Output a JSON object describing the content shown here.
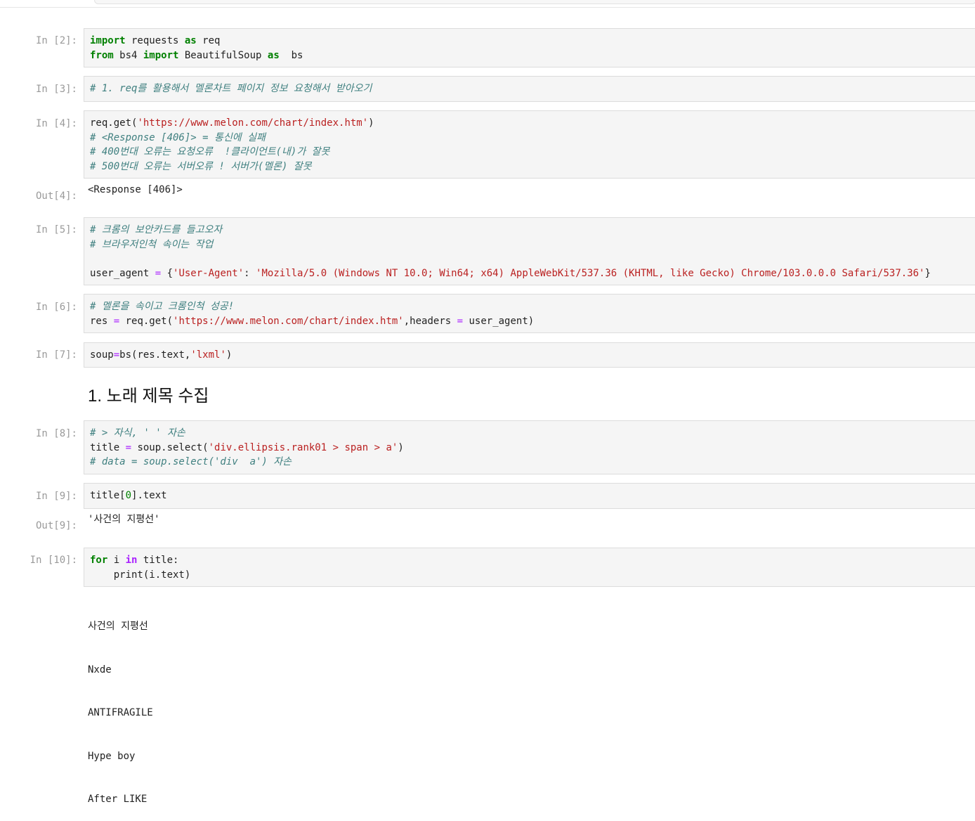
{
  "cells": [
    {
      "prompt": "In [2]:",
      "lines": [
        [
          [
            "kw",
            "import"
          ],
          [
            "t",
            " requests "
          ],
          [
            "kw",
            "as"
          ],
          [
            "t",
            " req"
          ]
        ],
        [
          [
            "kw",
            "from"
          ],
          [
            "t",
            " bs4 "
          ],
          [
            "kw",
            "import"
          ],
          [
            "t",
            " BeautifulSoup "
          ],
          [
            "kw",
            "as"
          ],
          [
            "t",
            "  bs"
          ]
        ]
      ]
    },
    {
      "prompt": "In [3]:",
      "lines": [
        [
          [
            "cm",
            "# 1. req를 활용해서 멜론차트 페이지 정보 요청해서 받아오기"
          ]
        ]
      ]
    },
    {
      "prompt": "In [4]:",
      "lines": [
        [
          [
            "t",
            "req.get("
          ],
          [
            "str",
            "'https://www.melon.com/chart/index.htm'"
          ],
          [
            "t",
            ")"
          ]
        ],
        [
          [
            "cm",
            "# <Response [406]> = 통신에 실패"
          ]
        ],
        [
          [
            "cm",
            "# 400번대 오류는 요청오류  !클라이언트(내)가 잘못"
          ]
        ],
        [
          [
            "cm",
            "# 500번대 오류는 서버오류 ! 서버가(멜론) 잘못"
          ]
        ]
      ],
      "out_prompt": "Out[4]:",
      "output": "<Response [406]>"
    },
    {
      "prompt": "In [5]:",
      "lines": [
        [
          [
            "cm",
            "# 크롬의 보안카드를 들고오자"
          ]
        ],
        [
          [
            "cm",
            "# 브라우저인척 속이는 작업"
          ]
        ],
        [
          [
            "t",
            ""
          ]
        ],
        [
          [
            "t",
            "user_agent "
          ],
          [
            "opn",
            "="
          ],
          [
            "t",
            " {"
          ],
          [
            "str",
            "'User-Agent'"
          ],
          [
            "t",
            ": "
          ],
          [
            "str",
            "'Mozilla/5.0 (Windows NT 10.0; Win64; x64) AppleWebKit/537.36 (KHTML, like Gecko) Chrome/103.0.0.0 Safari/537.36'"
          ],
          [
            "t",
            "}"
          ]
        ]
      ]
    },
    {
      "prompt": "In [6]:",
      "lines": [
        [
          [
            "cm",
            "# 멜론을 속이고 크롬인척 성공!"
          ]
        ],
        [
          [
            "t",
            "res "
          ],
          [
            "opn",
            "="
          ],
          [
            "t",
            " req.get("
          ],
          [
            "str",
            "'https://www.melon.com/chart/index.htm'"
          ],
          [
            "t",
            ",headers "
          ],
          [
            "opn",
            "="
          ],
          [
            "t",
            " user_agent)"
          ]
        ]
      ]
    },
    {
      "prompt": "In [7]:",
      "lines": [
        [
          [
            "t",
            "soup"
          ],
          [
            "opn",
            "="
          ],
          [
            "t",
            "bs(res.text,"
          ],
          [
            "str",
            "'lxml'"
          ],
          [
            "t",
            ")"
          ]
        ]
      ]
    },
    {
      "prompt": "In [8]:",
      "lines": [
        [
          [
            "cm",
            "# > 자식, ' ' 자손"
          ]
        ],
        [
          [
            "t",
            "title "
          ],
          [
            "opn",
            "="
          ],
          [
            "t",
            " soup.select("
          ],
          [
            "str",
            "'div.ellipsis.rank01 > span > a'"
          ],
          [
            "t",
            ")"
          ]
        ],
        [
          [
            "cm",
            "# data = soup.select('div  a') 자손"
          ]
        ]
      ]
    },
    {
      "prompt": "In [9]:",
      "lines": [
        [
          [
            "t",
            "title["
          ],
          [
            "num",
            "0"
          ],
          [
            "t",
            "].text"
          ]
        ]
      ],
      "out_prompt": "Out[9]:",
      "output": "'사건의 지평선'"
    },
    {
      "prompt": "In [10]:",
      "lines": [
        [
          [
            "kw",
            "for"
          ],
          [
            "t",
            " i "
          ],
          [
            "op",
            "in"
          ],
          [
            "t",
            " title:"
          ]
        ],
        [
          [
            "t",
            "    print(i.text)"
          ]
        ]
      ],
      "stream_output": [
        "사건의 지평선",
        "Nxde",
        "ANTIFRAGILE",
        "Hype boy",
        "After LIKE"
      ]
    }
  ],
  "markdown_heading": "1. 노래 제목 수집"
}
